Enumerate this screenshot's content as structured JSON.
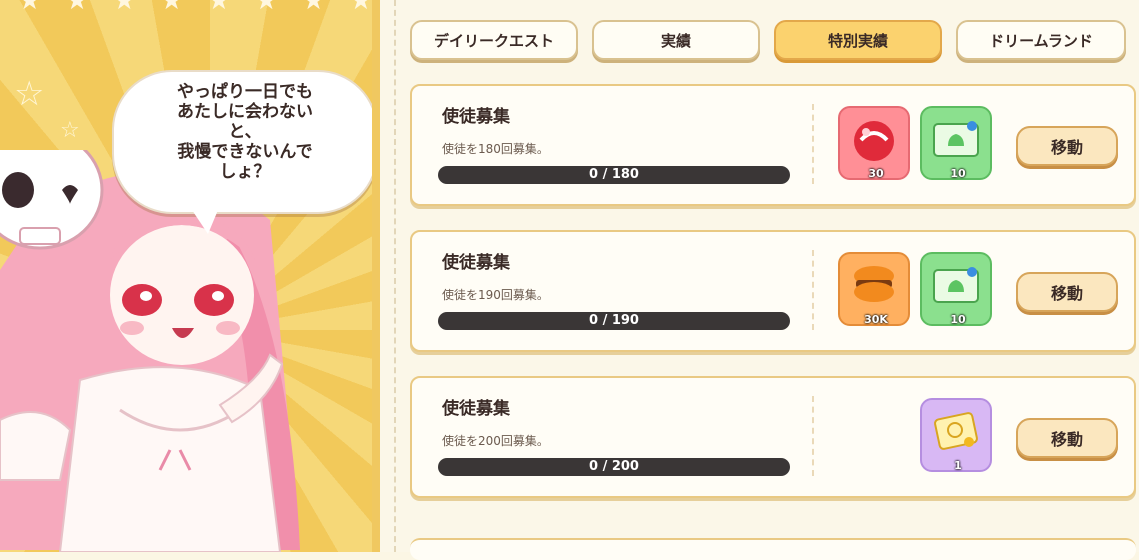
{
  "speech": {
    "text": "やっぱり一日でも\nあたしに会わない\nと、\n我慢できないんで\nしょ？"
  },
  "tabs": [
    {
      "label": "デイリークエスト",
      "active": false
    },
    {
      "label": "実績",
      "active": false
    },
    {
      "label": "特別実績",
      "active": true
    },
    {
      "label": "ドリームランド",
      "active": false
    }
  ],
  "quests": [
    {
      "title": "使徒募集",
      "description": "使徒を180回募集。",
      "progress_text": "0 / 180",
      "progress": 0,
      "rewards": [
        {
          "icon": "red-candy-icon",
          "count": "30",
          "color": "red"
        },
        {
          "icon": "green-ticket-icon",
          "count": "10",
          "color": "green"
        }
      ],
      "button": "移動"
    },
    {
      "title": "使徒募集",
      "description": "使徒を190回募集。",
      "progress_text": "0 / 190",
      "progress": 0,
      "rewards": [
        {
          "icon": "macaron-icon",
          "count": "30K",
          "color": "orange"
        },
        {
          "icon": "green-ticket-icon",
          "count": "10",
          "color": "green"
        }
      ],
      "button": "移動"
    },
    {
      "title": "使徒募集",
      "description": "使徒を200回募集。",
      "progress_text": "0 / 200",
      "progress": 0,
      "rewards": [
        {
          "icon": "gold-ticket-icon",
          "count": "1",
          "color": "purple"
        }
      ],
      "button": "移動"
    }
  ]
}
